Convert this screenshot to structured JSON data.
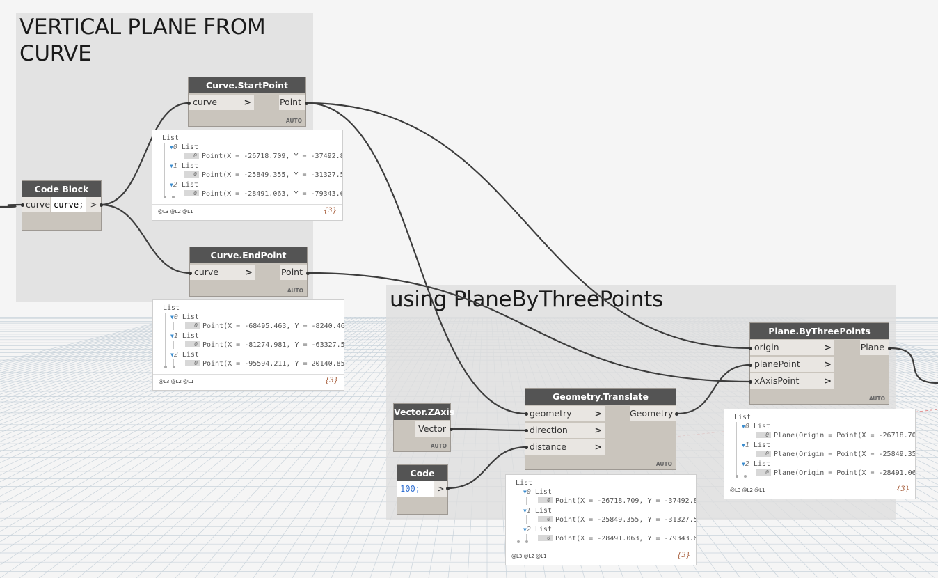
{
  "groups": {
    "vertical_plane": {
      "title_line1": "VERTICAL PLANE FROM",
      "title_line2": "CURVE"
    },
    "plane_by_three": {
      "title": "using PlaneByThreePoints"
    }
  },
  "nodes": {
    "code_block_curve": {
      "title": "Code Block",
      "input": "curve",
      "code": "curve;",
      "output": ">"
    },
    "curve_start_point": {
      "title": "Curve.StartPoint",
      "input": "curve",
      "input_chev": ">",
      "output": "Point",
      "lacing": "AUTO"
    },
    "curve_end_point": {
      "title": "Curve.EndPoint",
      "input": "curve",
      "input_chev": ">",
      "output": "Point",
      "lacing": "AUTO"
    },
    "vector_zaxis": {
      "title": "Vector.ZAxis",
      "output": "Vector",
      "lacing": "AUTO"
    },
    "code_block_100": {
      "title": "Code Block",
      "code": "100;",
      "output": ">"
    },
    "geometry_translate": {
      "title": "Geometry.Translate",
      "inputs": [
        "geometry",
        "direction",
        "distance"
      ],
      "input_chev": ">",
      "output": "Geometry",
      "lacing": "AUTO"
    },
    "plane_by_three_points": {
      "title": "Plane.ByThreePoints",
      "inputs": [
        "origin",
        "planePoint",
        "xAxisPoint"
      ],
      "input_chev": ">",
      "output": "Plane",
      "lacing": "AUTO"
    }
  },
  "previews": {
    "start_point": {
      "root": "List",
      "items": [
        {
          "idx": "0",
          "label": "List",
          "sub_idx": "0",
          "value": "Point(X = -26718.709, Y = -37492.8"
        },
        {
          "idx": "1",
          "label": "List",
          "sub_idx": "0",
          "value": "Point(X = -25849.355, Y = -31327.5"
        },
        {
          "idx": "2",
          "label": "List",
          "sub_idx": "0",
          "value": "Point(X = -28491.063, Y = -79343.6"
        }
      ],
      "levels": "@L3 @L2 @L1",
      "count": "{3}"
    },
    "end_point": {
      "root": "List",
      "items": [
        {
          "idx": "0",
          "label": "List",
          "sub_idx": "0",
          "value": "Point(X = -68495.463, Y = -8240.46"
        },
        {
          "idx": "1",
          "label": "List",
          "sub_idx": "0",
          "value": "Point(X = -81274.981, Y = -63327.5"
        },
        {
          "idx": "2",
          "label": "List",
          "sub_idx": "0",
          "value": "Point(X = -95594.211, Y = 20140.85"
        }
      ],
      "levels": "@L3 @L2 @L1",
      "count": "{3}"
    },
    "translate": {
      "root": "List",
      "items": [
        {
          "idx": "0",
          "label": "List",
          "sub_idx": "0",
          "value": "Point(X = -26718.709, Y = -37492.8"
        },
        {
          "idx": "1",
          "label": "List",
          "sub_idx": "0",
          "value": "Point(X = -25849.355, Y = -31327.5"
        },
        {
          "idx": "2",
          "label": "List",
          "sub_idx": "0",
          "value": "Point(X = -28491.063, Y = -79343.6"
        }
      ],
      "levels": "@L3 @L2 @L1",
      "count": "{3}"
    },
    "plane": {
      "root": "List",
      "items": [
        {
          "idx": "0",
          "label": "List",
          "sub_idx": "0",
          "value": "Plane(Origin = Point(X = -26718.70"
        },
        {
          "idx": "1",
          "label": "List",
          "sub_idx": "0",
          "value": "Plane(Origin = Point(X = -25849.35"
        },
        {
          "idx": "2",
          "label": "List",
          "sub_idx": "0",
          "value": "Plane(Origin = Point(X = -28491.06"
        }
      ],
      "levels": "@L3 @L2 @L1",
      "count": "{3}"
    }
  },
  "colors": {
    "canvas_bg": "#f5f5f5",
    "grid": "#c9d3db",
    "node_header": "#545454",
    "node_body": "#cac5bd",
    "wire": "#3d3d3d",
    "code_number": "#2f6fd1"
  }
}
